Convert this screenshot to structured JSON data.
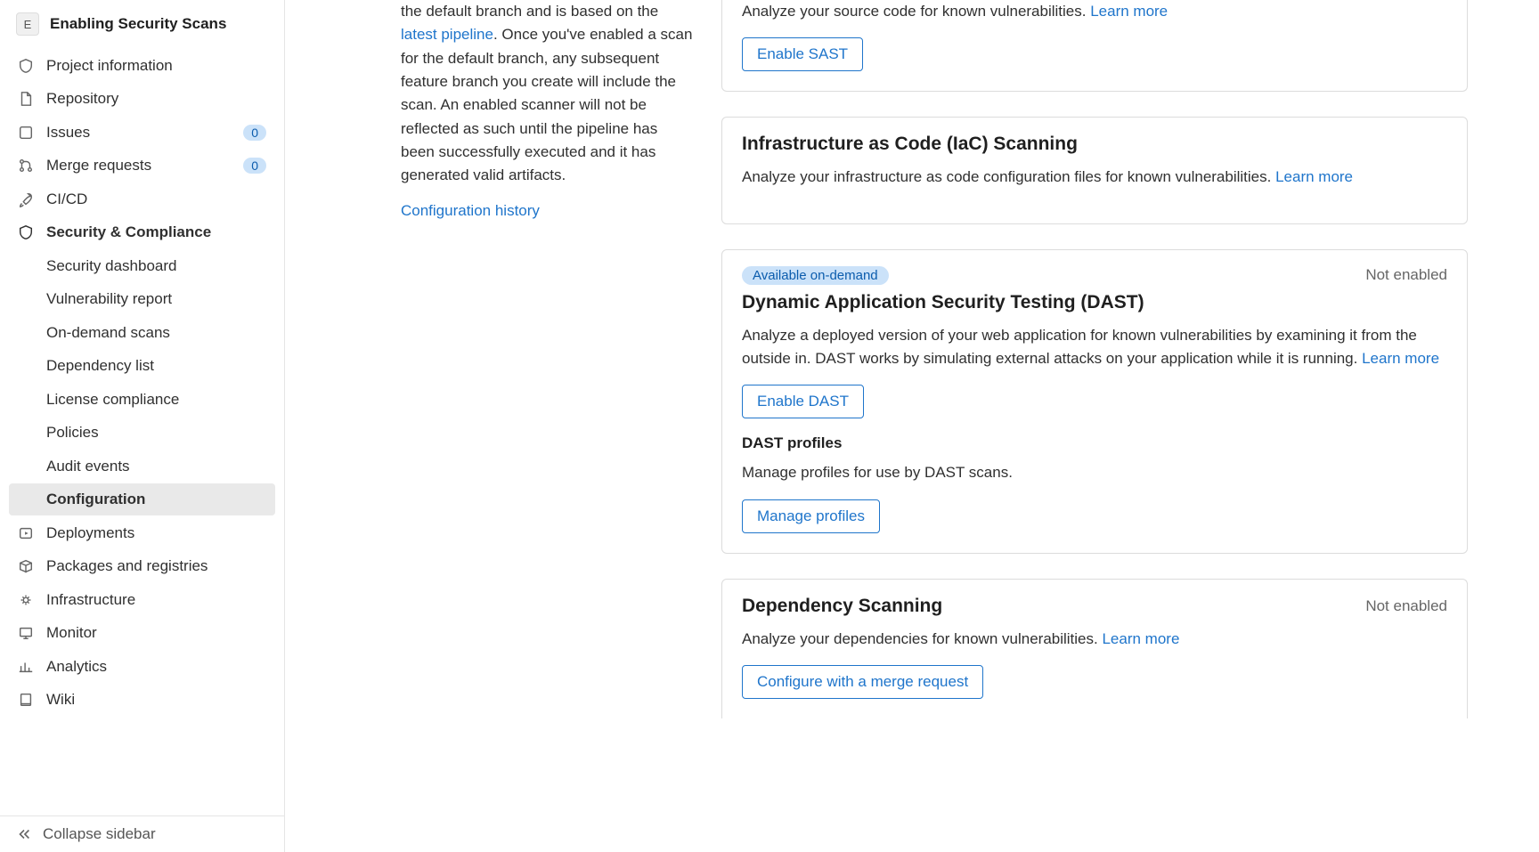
{
  "sidebar": {
    "project_letter": "E",
    "project_name": "Enabling Security Scans",
    "items": [
      {
        "label": "Project information"
      },
      {
        "label": "Repository"
      },
      {
        "label": "Issues",
        "badge": "0"
      },
      {
        "label": "Merge requests",
        "badge": "0"
      },
      {
        "label": "CI/CD"
      },
      {
        "label": "Security & Compliance",
        "bold": true
      },
      {
        "label": "Deployments"
      },
      {
        "label": "Packages and registries"
      },
      {
        "label": "Infrastructure"
      },
      {
        "label": "Monitor"
      },
      {
        "label": "Analytics"
      },
      {
        "label": "Wiki"
      }
    ],
    "sub_items": [
      {
        "label": "Security dashboard"
      },
      {
        "label": "Vulnerability report"
      },
      {
        "label": "On-demand scans"
      },
      {
        "label": "Dependency list"
      },
      {
        "label": "License compliance"
      },
      {
        "label": "Policies"
      },
      {
        "label": "Audit events"
      },
      {
        "label": "Configuration",
        "active": true
      }
    ],
    "collapse_label": "Collapse sidebar"
  },
  "intro": {
    "text_pre": "the default branch and is based on the ",
    "link1": "latest pipeline",
    "text_post": ". Once you've enabled a scan for the default branch, any subsequent feature branch you create will include the scan. An enabled scanner will not be reflected as such until the pipeline has been successfully executed and it has generated valid artifacts.",
    "config_history": "Configuration history"
  },
  "cards": {
    "sast": {
      "desc": "Analyze your source code for known vulnerabilities. ",
      "learn_more": "Learn more",
      "button": "Enable SAST"
    },
    "iac": {
      "title": "Infrastructure as Code (IaC) Scanning",
      "desc": "Analyze your infrastructure as code configuration files for known vulnerabilities. ",
      "learn_more": "Learn more"
    },
    "dast": {
      "pill": "Available on-demand",
      "status": "Not enabled",
      "title": "Dynamic Application Security Testing (DAST)",
      "desc": "Analyze a deployed version of your web application for known vulnerabilities by examining it from the outside in. DAST works by simulating external attacks on your application while it is running. ",
      "learn_more": "Learn more",
      "button": "Enable DAST",
      "profiles_title": "DAST profiles",
      "profiles_desc": "Manage profiles for use by DAST scans.",
      "profiles_button": "Manage profiles"
    },
    "dependency": {
      "title": "Dependency Scanning",
      "status": "Not enabled",
      "desc": "Analyze your dependencies for known vulnerabilities. ",
      "learn_more": "Learn more",
      "button": "Configure with a merge request"
    }
  }
}
